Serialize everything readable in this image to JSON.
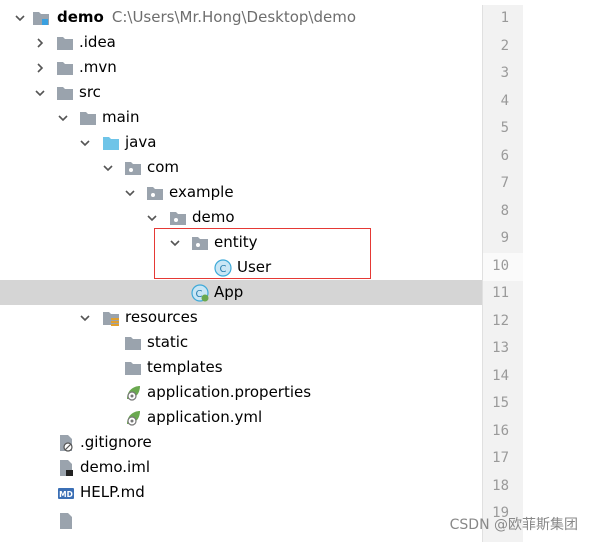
{
  "project": {
    "name": "demo",
    "path": "C:\\Users\\Mr.Hong\\Desktop\\demo"
  },
  "tree": {
    "idea": ".idea",
    "mvn": ".mvn",
    "src": "src",
    "main": "main",
    "java": "java",
    "com": "com",
    "example": "example",
    "demo_pkg": "demo",
    "entity": "entity",
    "user": "User",
    "app": "App",
    "resources": "resources",
    "static": "static",
    "templates": "templates",
    "app_properties": "application.properties",
    "app_yml": "application.yml",
    "gitignore": ".gitignore",
    "demo_iml": "demo.iml",
    "help_md": "HELP.md"
  },
  "line_numbers": [
    "1",
    "2",
    "3",
    "4",
    "5",
    "6",
    "7",
    "8",
    "9",
    "10",
    "11",
    "12",
    "13",
    "14",
    "15",
    "16",
    "17",
    "18",
    "19"
  ],
  "watermark": "CSDN @欧菲斯集团",
  "colors": {
    "selection": "#d5d5d5",
    "highlight_box": "#e53935",
    "java_folder": "#6ec4e8",
    "class_icon": "#3da9d8",
    "spring_icon": "#6aa84f"
  }
}
